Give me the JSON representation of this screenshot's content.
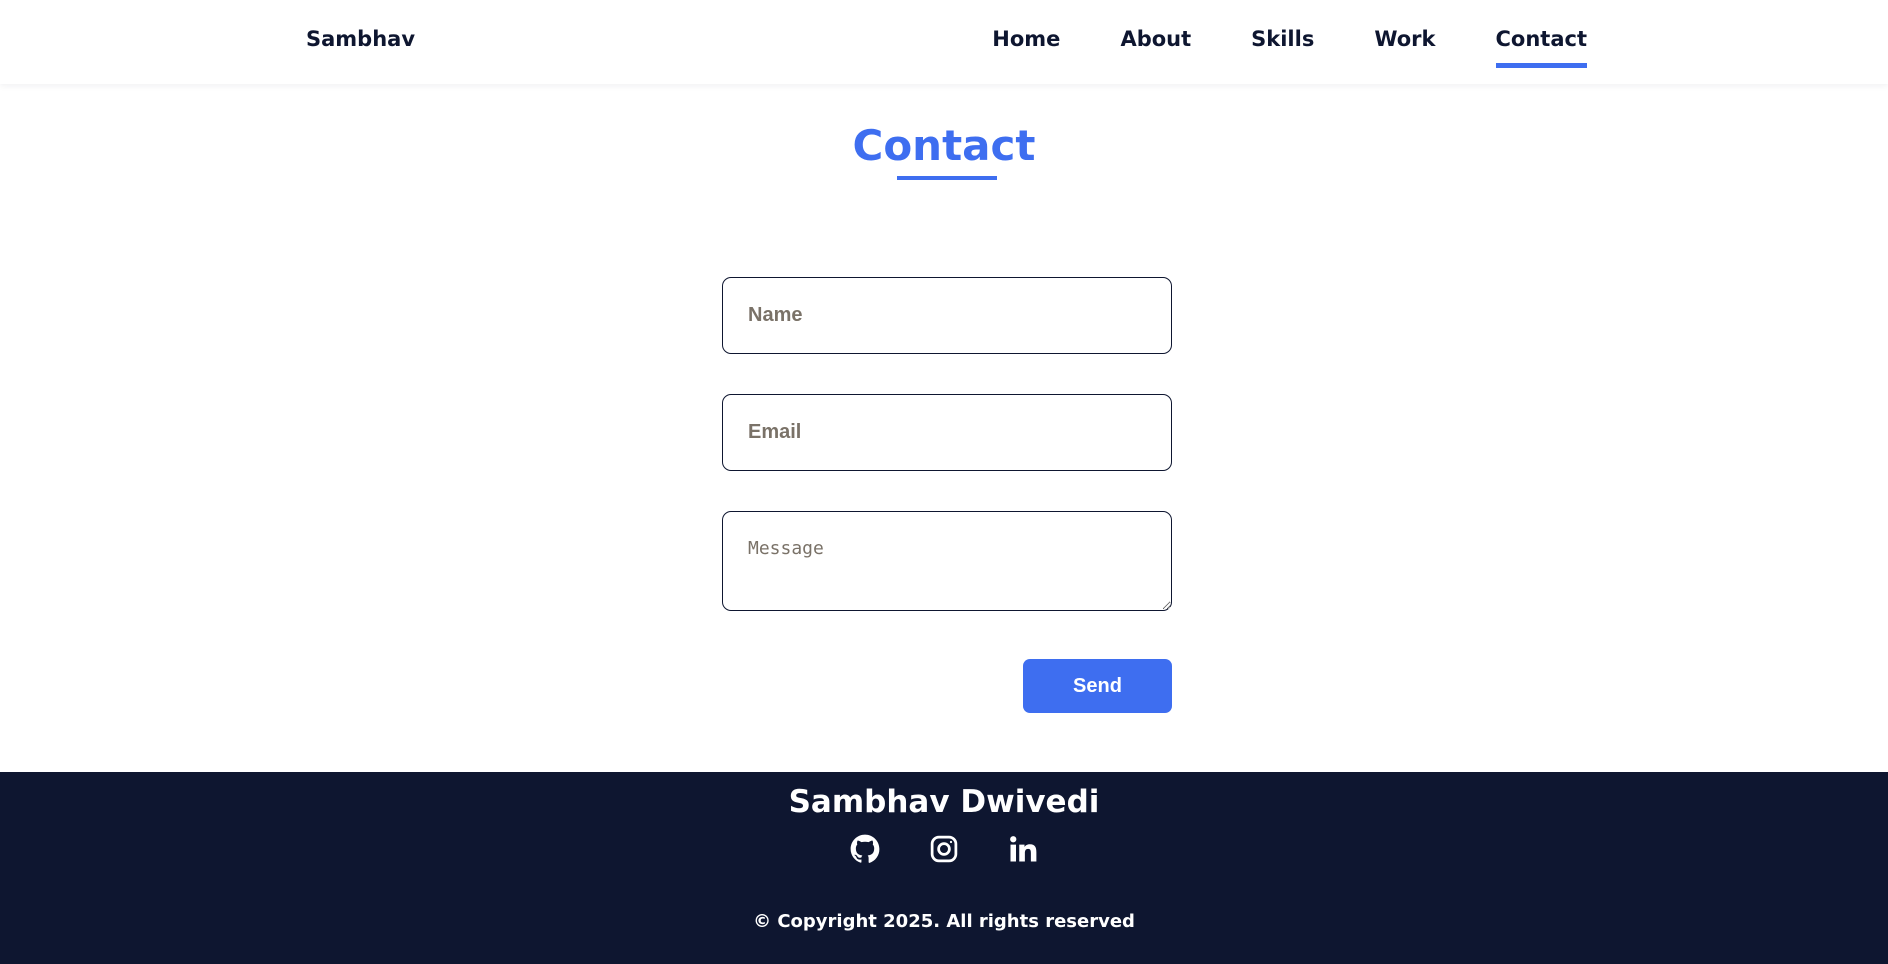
{
  "header": {
    "brand": "Sambhav",
    "nav": [
      {
        "label": "Home",
        "active": false
      },
      {
        "label": "About",
        "active": false
      },
      {
        "label": "Skills",
        "active": false
      },
      {
        "label": "Work",
        "active": false
      },
      {
        "label": "Contact",
        "active": true
      }
    ]
  },
  "main": {
    "title": "Contact",
    "form": {
      "name_placeholder": "Name",
      "email_placeholder": "Email",
      "message_placeholder": "Message",
      "send_label": "Send"
    }
  },
  "footer": {
    "name": "Sambhav Dwivedi",
    "socials": [
      {
        "icon": "github-icon"
      },
      {
        "icon": "instagram-icon"
      },
      {
        "icon": "linkedin-icon"
      }
    ],
    "copyright": "© Copyright 2025. All rights reserved"
  },
  "colors": {
    "accent": "#3e6ef0",
    "dark": "#0e1630",
    "placeholder": "#7a7268",
    "background": "#ffffff"
  }
}
